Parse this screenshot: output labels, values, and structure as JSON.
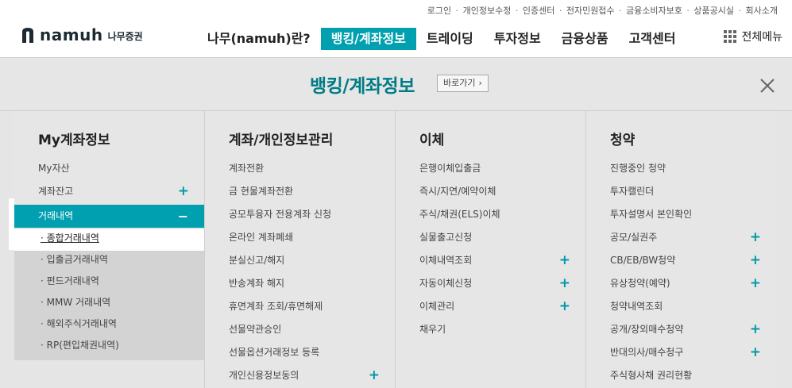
{
  "utility_links": [
    "로그인",
    "개인정보수정",
    "인증센터",
    "전자민원접수",
    "금융소비자보호",
    "상품공시실",
    "회사소개"
  ],
  "logo": {
    "name": "namuh",
    "sub": "나무증권"
  },
  "gnb": [
    {
      "label": "나무(namuh)란?",
      "active": false
    },
    {
      "label": "뱅킹/계좌정보",
      "active": true
    },
    {
      "label": "트레이딩",
      "active": false
    },
    {
      "label": "투자정보",
      "active": false
    },
    {
      "label": "금융상품",
      "active": false
    },
    {
      "label": "고객센터",
      "active": false
    }
  ],
  "all_menu_label": "전체메뉴",
  "band": {
    "title": "뱅킹/계좌정보",
    "goto_label": "바로가기"
  },
  "accent_color": "#00a0b0",
  "columns": [
    {
      "title": "My계좌정보",
      "items": [
        {
          "label": "My자산",
          "expand": false
        },
        {
          "label": "계좌잔고",
          "expand": true
        },
        {
          "label": "거래내역",
          "expand": false,
          "active": true
        }
      ],
      "sub_items": [
        "· 종합거래내역",
        "· 입출금거래내역",
        "· 펀드거래내역",
        "· MMW 거래내역",
        "· 해외주식거래내역",
        "· RP(편입채권내역)"
      ]
    },
    {
      "title": "계좌/개인정보관리",
      "items": [
        {
          "label": "계좌전환",
          "expand": false
        },
        {
          "label": "금 현물계좌전환",
          "expand": false
        },
        {
          "label": "공모투융자 전용계좌 신청",
          "expand": false
        },
        {
          "label": "온라인 계좌폐쇄",
          "expand": false
        },
        {
          "label": "분실신고/해지",
          "expand": false
        },
        {
          "label": "반송계좌 해지",
          "expand": false
        },
        {
          "label": "휴면계좌 조회/휴면해제",
          "expand": false
        },
        {
          "label": "선물약관승인",
          "expand": false
        },
        {
          "label": "선물옵션거래정보 등록",
          "expand": false
        },
        {
          "label": "개인신용정보동의",
          "expand": true
        }
      ]
    },
    {
      "title": "이체",
      "items": [
        {
          "label": "은행이체입출금",
          "expand": false
        },
        {
          "label": "즉시/지연/예약이체",
          "expand": false
        },
        {
          "label": "주식/채권(ELS)이체",
          "expand": false
        },
        {
          "label": "실물출고신청",
          "expand": false
        },
        {
          "label": "이체내역조회",
          "expand": true
        },
        {
          "label": "자동이체신청",
          "expand": true
        },
        {
          "label": "이체관리",
          "expand": true
        },
        {
          "label": "채우기",
          "expand": false
        }
      ]
    },
    {
      "title": "청약",
      "items": [
        {
          "label": "진행중인 청약",
          "expand": false
        },
        {
          "label": "투자캘린더",
          "expand": false
        },
        {
          "label": "투자설명서 본인확인",
          "expand": false
        },
        {
          "label": "공모/실권주",
          "expand": true
        },
        {
          "label": "CB/EB/BW청약",
          "expand": true
        },
        {
          "label": "유상청약(예약)",
          "expand": true
        },
        {
          "label": "청약내역조회",
          "expand": false
        },
        {
          "label": "공개/장외매수청약",
          "expand": true
        },
        {
          "label": "반대의사/매수청구",
          "expand": true
        },
        {
          "label": "주식형사채 권리현황",
          "expand": false
        }
      ]
    }
  ],
  "symbols": {
    "plus": "+",
    "minus": "−",
    "chevron": "›"
  }
}
